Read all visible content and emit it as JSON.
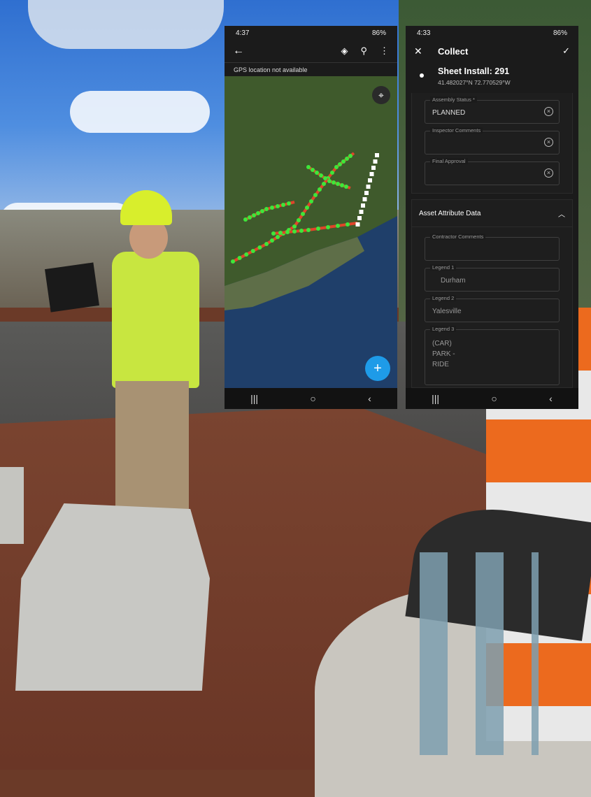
{
  "map_phone": {
    "status_time": "4:37",
    "battery": "86%",
    "gps_banner": "GPS location not available",
    "icons": [
      "back-arrow-icon",
      "layers-icon",
      "search-icon",
      "more-vert-icon",
      "locate-icon",
      "add-icon"
    ],
    "accent": "#1e9be8"
  },
  "collect_phone": {
    "status_time": "4:33",
    "battery": "86%",
    "title": "Collect",
    "feature_title": "Sheet Install: 291",
    "coords": "41.482027°N  72.770529°W",
    "fields": [
      {
        "label": "Assembly Status *",
        "value": "PLANNED"
      },
      {
        "label": "Inspector Comments",
        "value": ""
      },
      {
        "label": "Final Approval",
        "value": ""
      }
    ],
    "section_title": "Asset Attribute Data",
    "attr_fields": [
      {
        "label": "Contractor Comments",
        "value": ""
      },
      {
        "label": "Legend 1",
        "value": "Durham"
      },
      {
        "label": "Legend 2",
        "value": "Yalesville"
      },
      {
        "label": "Legend 3",
        "value": "(CAR)\nPARK -\nRIDE"
      }
    ]
  },
  "nav": {
    "recents": "|||",
    "home": "○",
    "back": "‹"
  }
}
